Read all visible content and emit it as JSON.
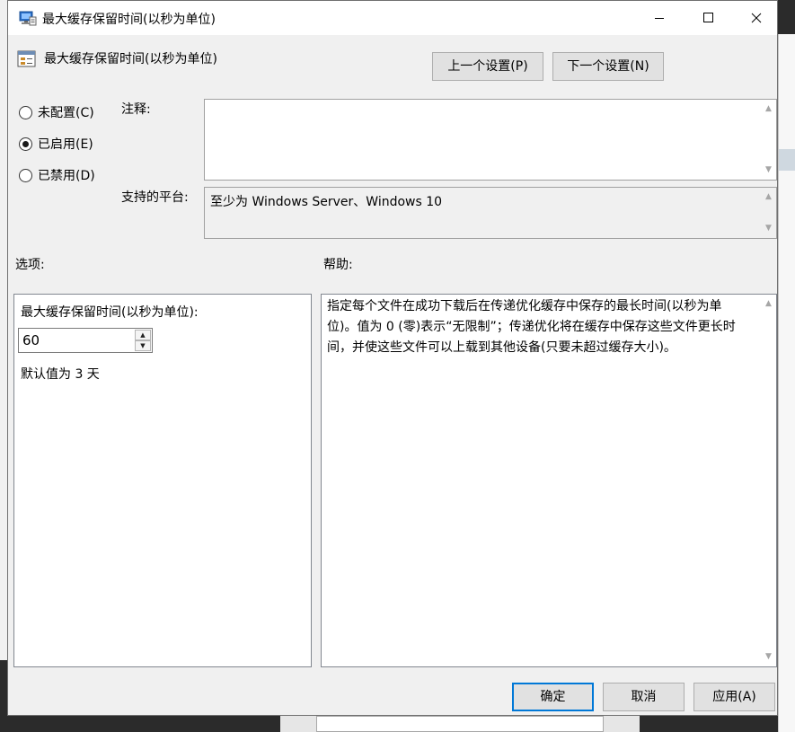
{
  "window": {
    "title": "最大缓存保留时间(以秒为单位)"
  },
  "header": {
    "setting_title": "最大缓存保留时间(以秒为单位)",
    "prev_button": "上一个设置(P)",
    "next_button": "下一个设置(N)"
  },
  "state": {
    "options": [
      {
        "label": "未配置(C)",
        "selected": false
      },
      {
        "label": "已启用(E)",
        "selected": true
      },
      {
        "label": "已禁用(D)",
        "selected": false
      }
    ]
  },
  "comment": {
    "label": "注释:",
    "value": ""
  },
  "platform": {
    "label": "支持的平台:",
    "value": "至少为 Windows Server、Windows 10"
  },
  "options_section": {
    "label": "选项:",
    "field_label": "最大缓存保留时间(以秒为单位):",
    "field_value": "60",
    "default_note": "默认值为 3 天"
  },
  "help_section": {
    "label": "帮助:",
    "text": "指定每个文件在成功下载后在传递优化缓存中保存的最长时间(以秒为单位)。值为 0 (零)表示“无限制”；传递优化将在缓存中保存这些文件更长时间，并使这些文件可以上载到其他设备(只要未超过缓存大小)。"
  },
  "footer": {
    "ok_button": "确定",
    "cancel_button": "取消",
    "apply_button": "应用(A)"
  },
  "colors": {
    "dialog_bg": "#f0f0f0",
    "focus_border": "#0078d7",
    "button_bg": "#e1e1e1"
  },
  "icons": {
    "app": "group-policy-icon",
    "setting": "policy-setting-icon"
  }
}
